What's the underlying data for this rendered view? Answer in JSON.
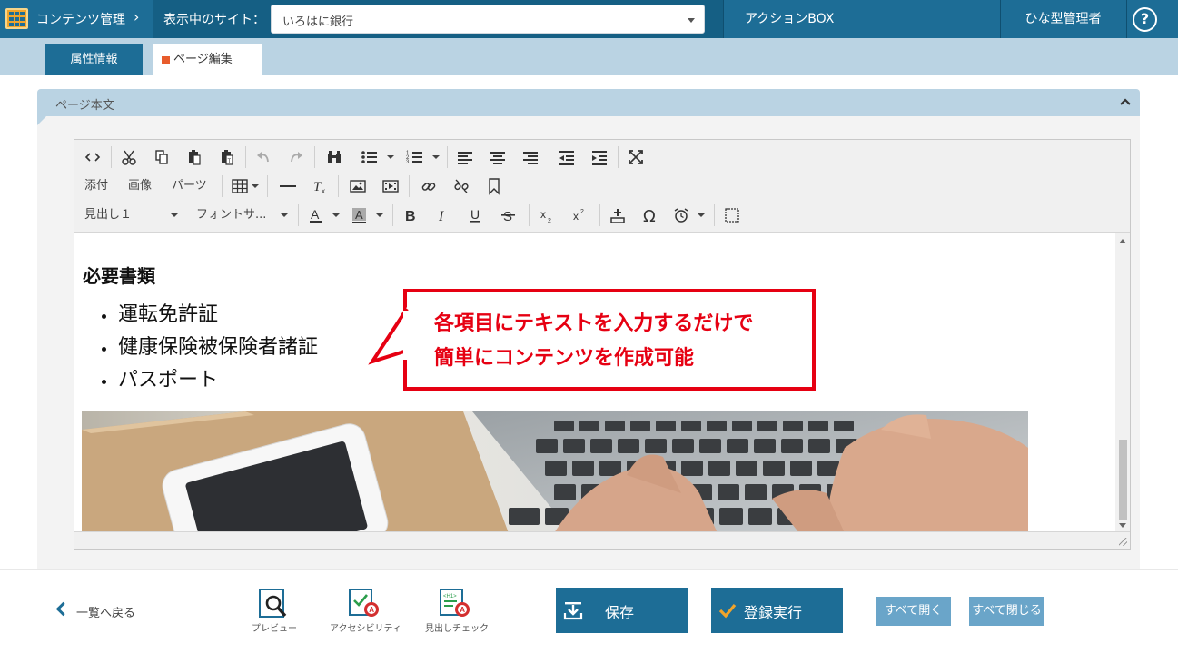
{
  "topbar": {
    "brand": "コンテンツ管理",
    "site_label": "表示中のサイト：",
    "site_value": "いろはに銀行",
    "action_box": "アクションBOX",
    "admin": "ひな型管理者",
    "help": "?"
  },
  "tabs": {
    "attributes": "属性情報",
    "page_edit": "ページ編集"
  },
  "panel": {
    "title": "ページ本文"
  },
  "toolbar": {
    "attach": "添付",
    "image": "画像",
    "parts": "パーツ",
    "heading_select": "見出し１",
    "font_size_select": "フォントサ..."
  },
  "content": {
    "heading": "必要書類",
    "items": [
      "運転免許証",
      "健康保険被保険者諸証",
      "パスポート"
    ]
  },
  "callout": {
    "line1": "各項目にテキストを入力するだけで",
    "line2": "簡単にコンテンツを作成可能"
  },
  "bottom": {
    "back": "一覧へ戻る",
    "preview": "プレビュー",
    "accessibility": "アクセシビリティ",
    "heading_check": "見出しチェック",
    "save": "保存",
    "register": "登録実行",
    "open_all": "すべて開く",
    "close_all": "すべて閉じる"
  },
  "colors": {
    "primary": "#1d6d96",
    "tab_strip": "#bad3e3",
    "callout": "#e60012",
    "light_button": "#6aa5c9"
  }
}
